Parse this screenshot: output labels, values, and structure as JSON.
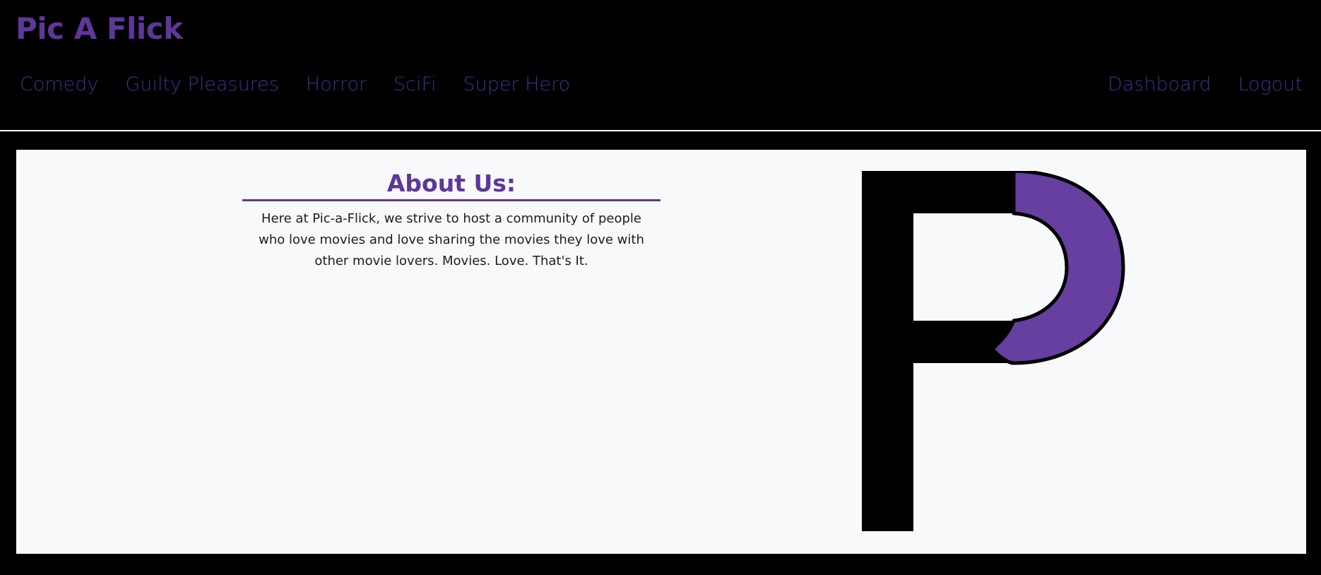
{
  "brand": "Pic A Flick",
  "nav": {
    "left": [
      "Comedy",
      "Guilty Pleasures",
      "Horror",
      "SciFi",
      "Super Hero"
    ],
    "right": [
      "Dashboard",
      "Logout"
    ]
  },
  "about": {
    "title": "About Us:",
    "text": "Here at Pic-a-Flick, we strive to host a community of people who love movies and love sharing the movies they love with other movie lovers. Movies. Love. That's It."
  },
  "logo": {
    "icon": "p-logo-icon",
    "colors": {
      "primary": "#000000",
      "accent": "#663fa0"
    }
  },
  "colors": {
    "accent": "#5e3799",
    "nav_link": "#4a2b8c",
    "page_background": "#000000",
    "content_background": "#f7f9fa"
  }
}
